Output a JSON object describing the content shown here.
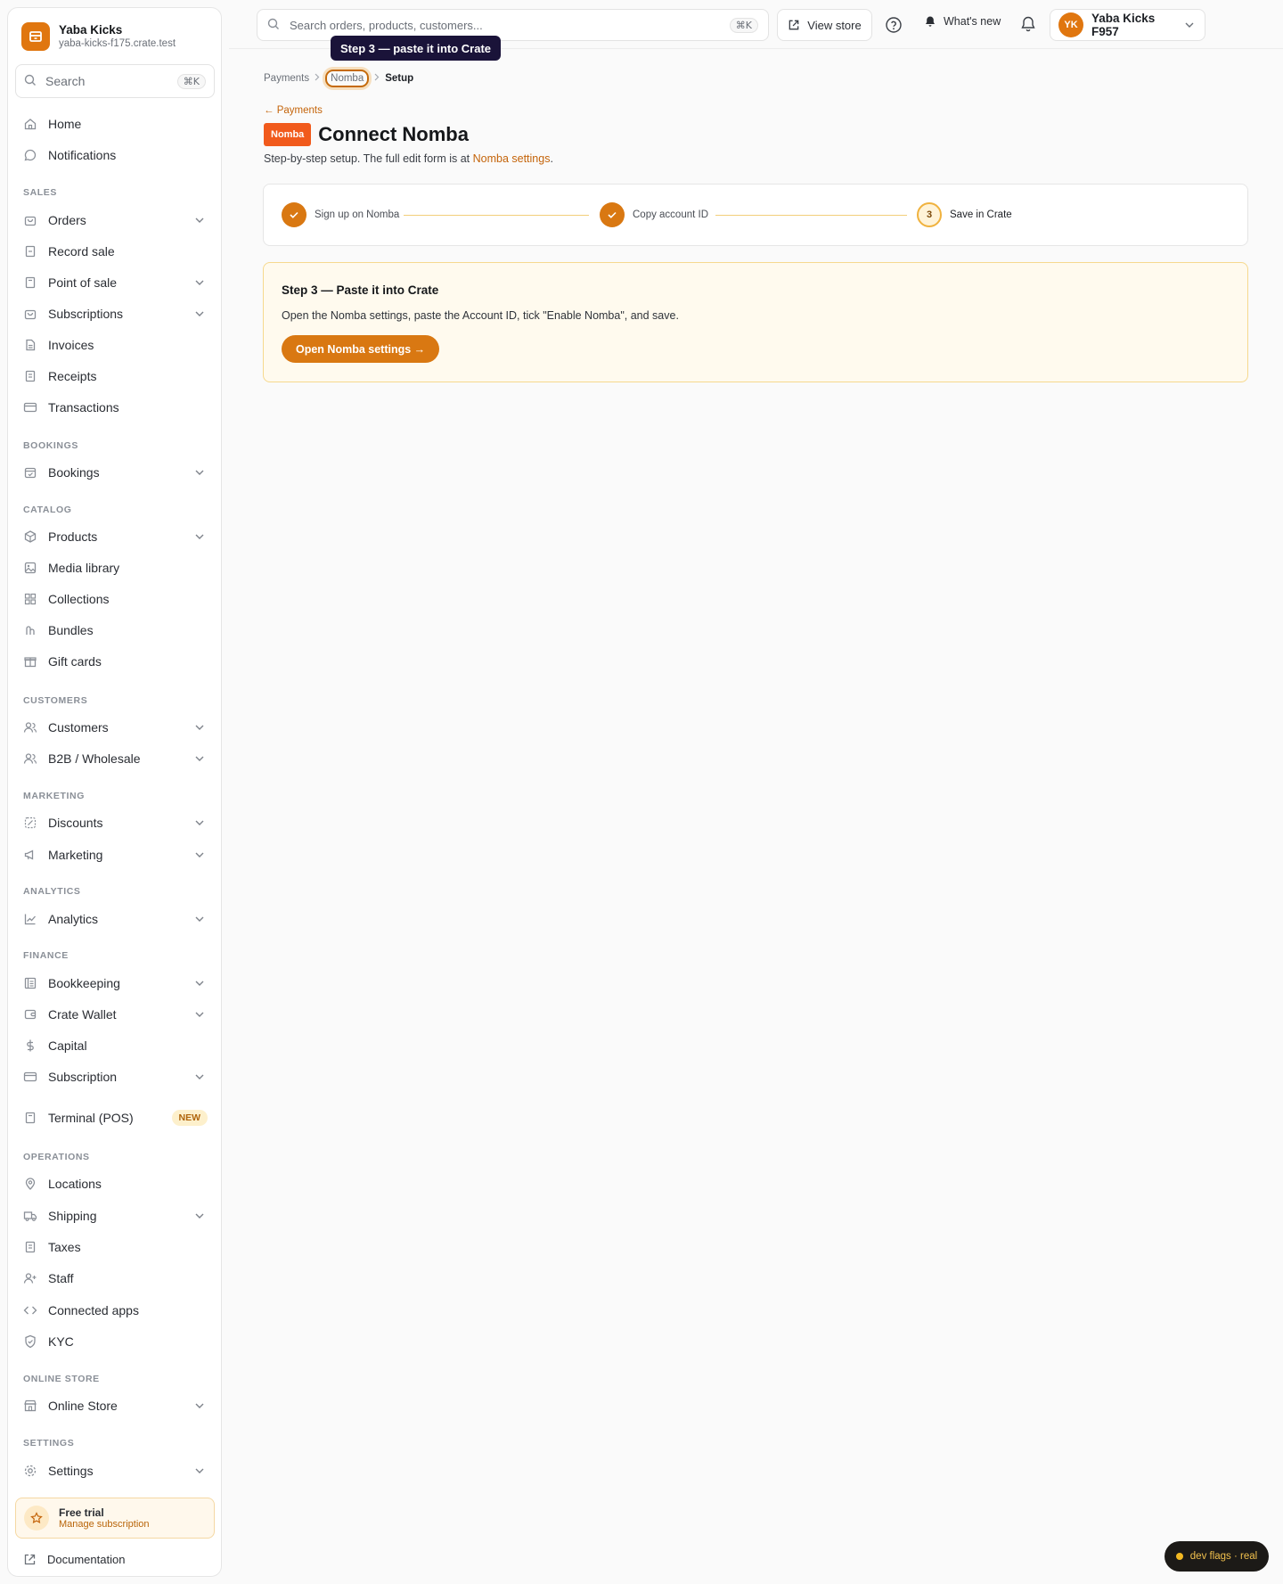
{
  "brand": {
    "name": "Yaba Kicks",
    "domain": "yaba-kicks-f175.crate.test"
  },
  "sidebar": {
    "search": {
      "label": "Search",
      "shortcut": "⌘K"
    },
    "items": {
      "home": "Home",
      "notifications": "Notifications",
      "orders": "Orders",
      "record_sale": "Record sale",
      "point_of_sale": "Point of sale",
      "subscriptions": "Subscriptions",
      "invoices": "Invoices",
      "receipts": "Receipts",
      "transactions": "Transactions",
      "bookings": "Bookings",
      "products": "Products",
      "media_library": "Media library",
      "collections": "Collections",
      "bundles": "Bundles",
      "gift_cards": "Gift cards",
      "customers": "Customers",
      "b2b": "B2B / Wholesale",
      "discounts": "Discounts",
      "marketing": "Marketing",
      "analytics": "Analytics",
      "bookkeeping": "Bookkeeping",
      "crate_wallet": "Crate Wallet",
      "capital": "Capital",
      "subscription": "Subscription",
      "terminal": "Terminal (POS)",
      "locations": "Locations",
      "shipping": "Shipping",
      "taxes": "Taxes",
      "staff": "Staff",
      "connected_apps": "Connected apps",
      "kyc": "KYC",
      "online_store": "Online Store",
      "settings": "Settings"
    },
    "badges": {
      "terminal": "NEW"
    },
    "sections": {
      "sales": "SALES",
      "bookings": "BOOKINGS",
      "catalog": "CATALOG",
      "customers": "CUSTOMERS",
      "marketing": "MARKETING",
      "analytics": "ANALYTICS",
      "finance": "FINANCE",
      "operations": "OPERATIONS",
      "online_store": "ONLINE STORE",
      "settings": "SETTINGS"
    },
    "trial": {
      "title": "Free trial",
      "subtitle": "Manage subscription"
    },
    "documentation": "Documentation"
  },
  "topbar": {
    "search_placeholder": "Search orders, products, customers...",
    "search_shortcut": "⌘K",
    "view_store": "View store",
    "whats_new": "What's new",
    "account": {
      "initials": "YK",
      "name": "Yaba Kicks F957"
    }
  },
  "tooltip": "Step 3 — paste it into Crate",
  "breadcrumb": {
    "payments": "Payments",
    "nomba": "Nomba",
    "setup": "Setup"
  },
  "page": {
    "back_link": "← Payments",
    "badge": "Nomba",
    "title": "Connect Nomba",
    "subtitle_prefix": "Step-by-step setup. The full edit form is at ",
    "subtitle_link": "Nomba settings",
    "subtitle_suffix": "."
  },
  "steps": [
    {
      "label": "Sign up on Nomba",
      "status": "done"
    },
    {
      "label": "Copy account ID",
      "status": "done"
    },
    {
      "label": "Save in Crate",
      "status": "current",
      "number": "3"
    }
  ],
  "card": {
    "title": "Step 3 — Paste it into Crate",
    "description": "Open the Nomba settings, paste the Account ID, tick \"Enable Nomba\", and save.",
    "button": "Open Nomba settings →"
  },
  "dev_flags": "dev flags · real",
  "colors": {
    "accent": "#d97812",
    "nomba_brand": "#f15a1c",
    "tooltip_bg": "#1a1339"
  }
}
